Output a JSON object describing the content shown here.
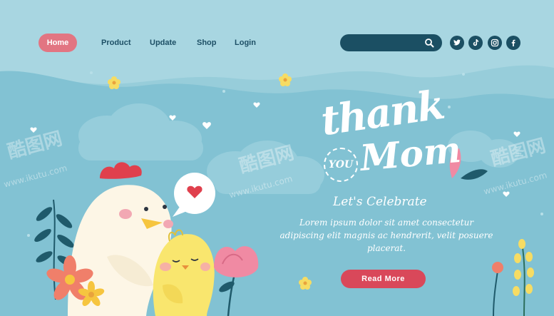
{
  "nav": {
    "home_label": "Home",
    "links": [
      "Product",
      "Update",
      "Shop",
      "Login"
    ],
    "search_placeholder": ""
  },
  "social": {
    "items": [
      {
        "name": "twitter",
        "glyph": "t"
      },
      {
        "name": "tiktok",
        "glyph": "♪"
      },
      {
        "name": "instagram",
        "glyph": "◎"
      },
      {
        "name": "facebook",
        "glyph": "f"
      }
    ]
  },
  "hero": {
    "title_line1": "thank",
    "title_you": "YOU",
    "title_line2": "Mom",
    "subtitle": "Let's Celebrate",
    "body": "Lorem ipsum dolor sit amet consectetur adipiscing elit magnis ac hendrerit, velit posuere placerat.",
    "cta_label": "Read More"
  },
  "watermark": {
    "brand": "酷图网",
    "url": "www.ikutu.com"
  },
  "colors": {
    "background": "#97cdda",
    "accent": "#e27582",
    "cta": "#d9485a",
    "dark": "#1b4f63"
  }
}
